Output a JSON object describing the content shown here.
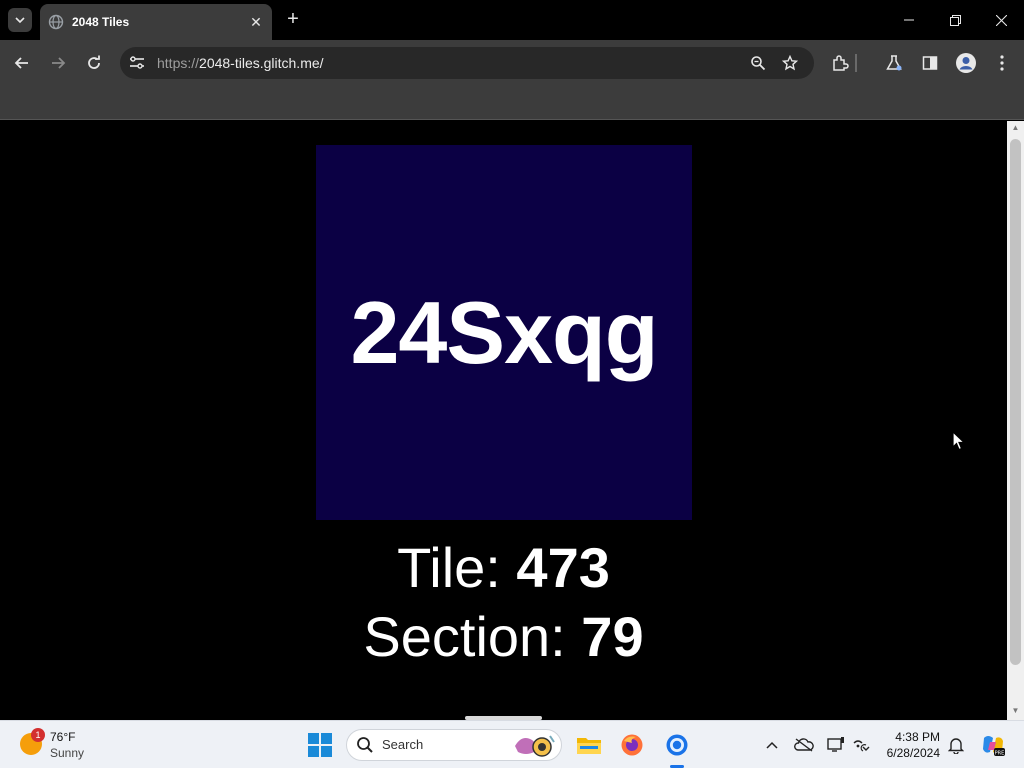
{
  "browser": {
    "tab_title": "2048 Tiles",
    "url_scheme": "https://",
    "url_host": "2048-tiles.glitch.me",
    "url_path": "/"
  },
  "page": {
    "tile_text": "24Sxqg",
    "tile_color": "#0b0044",
    "tile_label": "Tile: ",
    "tile_value": "473",
    "section_label": "Section: ",
    "section_value": "79"
  },
  "taskbar": {
    "weather_badge": "1",
    "weather_temp": "76°F",
    "weather_cond": "Sunny",
    "search_label": "Search",
    "clock_time": "4:38 PM",
    "clock_date": "6/28/2024"
  },
  "colors": {
    "accent": "#1a73e8",
    "tile_bg": "#0b0044"
  }
}
